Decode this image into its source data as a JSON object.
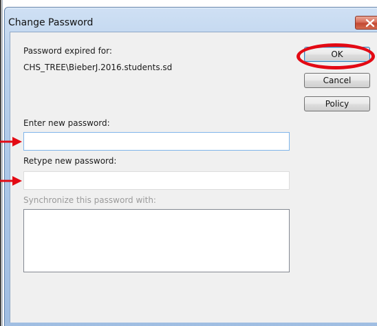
{
  "window": {
    "title": "Change Password",
    "close_label": "Close"
  },
  "info": {
    "expired_label": "Password expired for:",
    "account": "CHS_TREE\\BieberJ.2016.students.sd"
  },
  "buttons": {
    "ok": "OK",
    "cancel": "Cancel",
    "policy": "Policy"
  },
  "fields": {
    "new_password_label": "Enter new password:",
    "new_password_value": "",
    "retype_label": "Retype new password:",
    "retype_value": "",
    "sync_label": "Synchronize this password with:"
  },
  "annotations": {
    "highlight_color": "#e30a14",
    "icons": [
      "close-icon",
      "arrow-right-icon",
      "highlight-circle"
    ]
  }
}
